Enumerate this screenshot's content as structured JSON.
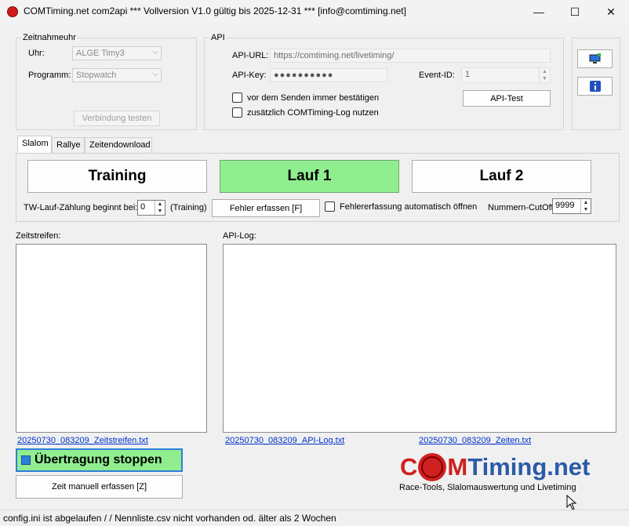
{
  "window": {
    "title": "COMTiming.net com2api *** Vollversion V1.0 gültig bis 2025-12-31 *** [info@comtiming.net]",
    "minimize": "—",
    "maximize": "☐",
    "close": "✕"
  },
  "zeitnahme": {
    "legend": "Zeitnahmeuhr",
    "uhr_label": "Uhr:",
    "uhr_value": "ALGE Timy3",
    "programm_label": "Programm:",
    "programm_value": "Stopwatch",
    "test_button": "Verbindung testen"
  },
  "api": {
    "legend": "API",
    "url_label": "API-URL:",
    "url_value": "https://comtiming.net/livetiming/",
    "key_label": "API-Key:",
    "key_value": "●●●●●●●●●●",
    "event_label": "Event-ID:",
    "event_value": "1",
    "confirm_label": "vor dem Senden immer bestätigen",
    "log_label": "zusätzlich COMTiming-Log nutzen",
    "test_button": "API-Test"
  },
  "tabs": [
    "Slalom",
    "Rallye",
    "Zeitendownload"
  ],
  "slalom": {
    "training": "Training",
    "lauf1": "Lauf 1",
    "lauf2": "Lauf 2",
    "tw_label": "TW-Lauf-Zählung beginnt bei:",
    "tw_value": "0",
    "tw_suffix": "(Training)",
    "fehler_button": "Fehler erfassen [F]",
    "auto_label": "Fehlererfassung automatisch öffnen",
    "cutoff_label": "Nummern-CutOff:",
    "cutoff_value": "9999"
  },
  "panels": {
    "zeitstreifen_label": "Zeitstreifen:",
    "apilog_label": "API-Log:",
    "zeitstreifen_file": "20250730_083209_Zeitstreifen.txt",
    "apilog_file": "20250730_083209_API-Log.txt",
    "zeiten_file": "20250730_083209_Zeiten.txt"
  },
  "actions": {
    "stop_button": "Übertragung stoppen",
    "manual_button": "Zeit manuell erfassen [Z]"
  },
  "logo": {
    "c": "C",
    "o": "O",
    "m": "M",
    "rest": "Timing.net",
    "tagline": "Race-Tools, Slalomauswertung und Livetiming"
  },
  "status": "config.ini ist abgelaufen /  / Nennliste.csv  nicht vorhanden od. älter als 2 Wochen",
  "colors": {
    "active": "#90ee90",
    "logo_red": "#d02020",
    "logo_blue": "#2b5aa8"
  }
}
